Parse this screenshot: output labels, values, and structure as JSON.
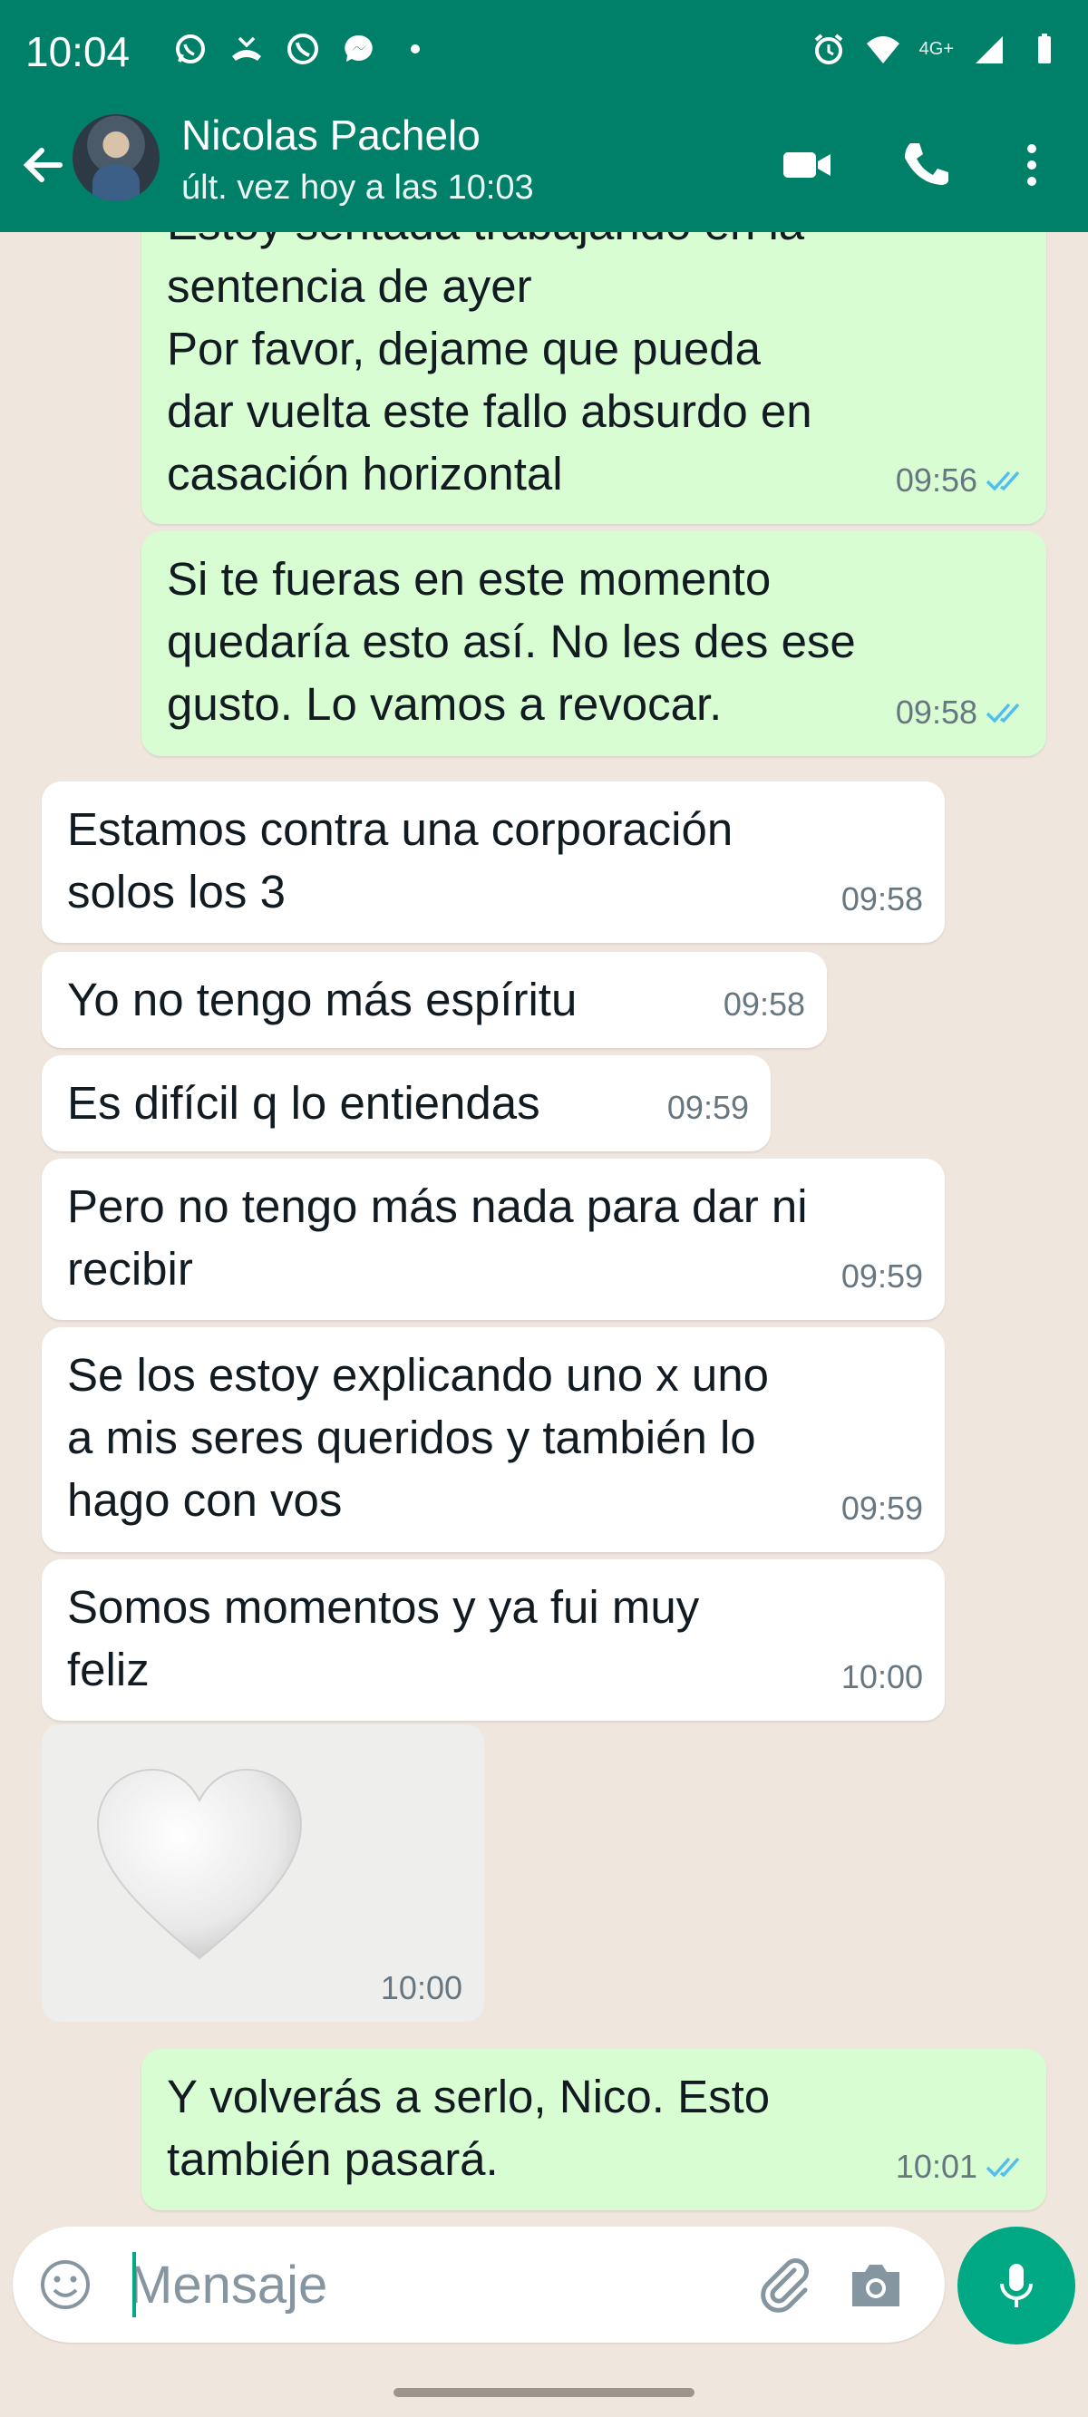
{
  "statusbar": {
    "time": "10:04",
    "network_label": "4G+"
  },
  "header": {
    "contact_name": "Nicolas Pachelo",
    "contact_status": "últ. vez hoy a las 10:03"
  },
  "messages": [
    {
      "direction": "out",
      "text": "Estoy sentada trabajando en la\nsentencia de ayer\nPor favor, dejame que pueda\ndar vuelta este fallo absurdo en\ncasación horizontal",
      "time": "09:56",
      "read": true
    },
    {
      "direction": "out",
      "text": "Si te fueras en este momento\nquedaría esto así. No les des ese\ngusto. Lo vamos a revocar.",
      "time": "09:58",
      "read": true
    },
    {
      "direction": "in",
      "text": "Estamos contra una corporación\nsolos los 3",
      "time": "09:58"
    },
    {
      "direction": "in",
      "text": "Yo no tengo más espíritu",
      "time": "09:58"
    },
    {
      "direction": "in",
      "text": "Es difícil q lo entiendas",
      "time": "09:59"
    },
    {
      "direction": "in",
      "text": "Pero no tengo más nada para dar ni\nrecibir",
      "time": "09:59"
    },
    {
      "direction": "in",
      "text": "Se los estoy explicando uno x uno\na mis seres queridos y también lo\nhago con vos",
      "time": "09:59"
    },
    {
      "direction": "in",
      "text": "Somos momentos y ya fui muy\nfeliz",
      "time": "10:00"
    },
    {
      "direction": "in",
      "type": "sticker",
      "sticker": "white-heart",
      "time": "10:00"
    },
    {
      "direction": "out",
      "text": "Y volverás a serlo, Nico. Esto\ntambién pasará.",
      "time": "10:01",
      "read": true
    }
  ],
  "composer": {
    "placeholder": "Mensaje"
  },
  "colors": {
    "header": "#008069",
    "outgoing_bubble": "#d9fdd3",
    "incoming_bubble": "#ffffff",
    "read_ticks": "#53bdeb",
    "mic_button": "#00a884"
  }
}
